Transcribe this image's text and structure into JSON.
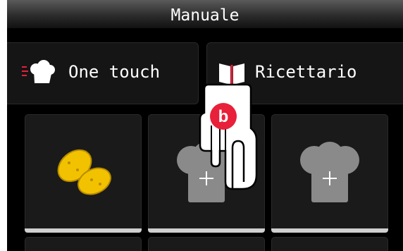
{
  "header": {
    "title": "Manuale"
  },
  "tabs": [
    {
      "label": "One touch",
      "icon": "chef-hat-speed-icon"
    },
    {
      "label": "Ricettario",
      "icon": "open-book-icon"
    }
  ],
  "tiles": [
    {
      "icon": "potatoes-icon"
    },
    {
      "icon": "add-chef-hat-icon"
    },
    {
      "icon": "add-chef-hat-icon"
    }
  ],
  "overlay": {
    "badge_letter": "b",
    "icon": "pointing-hand-icon"
  },
  "colors": {
    "accent_red": "#e8203a",
    "potato_yellow": "#f2c200",
    "hat_gray": "#8a8a8a"
  }
}
